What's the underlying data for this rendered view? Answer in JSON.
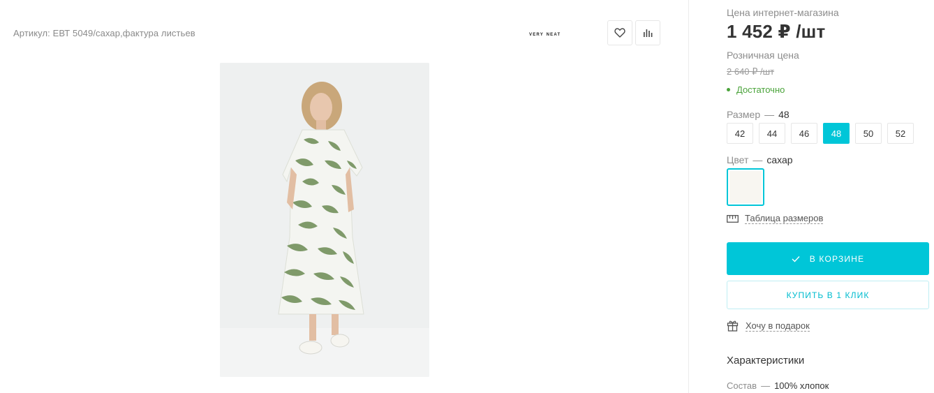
{
  "product": {
    "article": "Артикул: ЕВТ 5049/сахар,фактура листьев",
    "brand": "very neat"
  },
  "pricing": {
    "online_label": "Цена интернет-магазина",
    "online_price": "1 452 ₽ /шт",
    "retail_label": "Розничная цена",
    "retail_price": "2 640 ₽ /шт",
    "stock_status": "Достаточно"
  },
  "size": {
    "label": "Размер",
    "dash": "—",
    "selected": "48",
    "options": [
      "42",
      "44",
      "46",
      "48",
      "50",
      "52"
    ]
  },
  "color": {
    "label": "Цвет",
    "dash": "—",
    "selected": "сахар",
    "swatch_hex": "#f8f6f1"
  },
  "links": {
    "size_table": "Таблица размеров",
    "gift": "Хочу в подарок"
  },
  "buttons": {
    "in_cart": "В КОРЗИНЕ",
    "one_click": "КУПИТЬ В 1 КЛИК"
  },
  "characteristics": {
    "title": "Характеристики",
    "composition_label": "Состав",
    "dash": "—",
    "composition_value": "100% хлопок"
  },
  "colors": {
    "accent": "#00c6d8",
    "stock_green": "#4aa33a"
  }
}
